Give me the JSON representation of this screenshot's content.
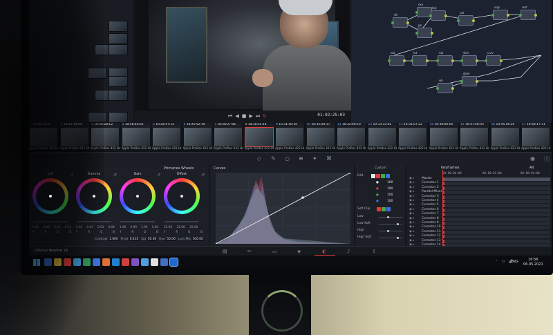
{
  "viewer": {
    "timecode": "01:02:25:03",
    "transport_icons": [
      "skip-back-icon",
      "play-reverse-icon",
      "stop-icon",
      "play-icon",
      "skip-forward-icon",
      "loop-icon"
    ]
  },
  "nodes": [
    {
      "label": "exp",
      "num": "01"
    },
    {
      "label": "dh",
      "num": "02"
    },
    {
      "label": "pp",
      "num": "03"
    },
    {
      "label": "sat",
      "num": "04"
    },
    {
      "label": "key",
      "num": "05"
    },
    {
      "label": "vign",
      "num": "06"
    },
    {
      "label": "rest",
      "num": "07"
    },
    {
      "label": "sat",
      "num": "08"
    },
    {
      "label": "lut",
      "num": "09"
    },
    {
      "label": "sat",
      "num": "10"
    },
    {
      "label": "skin",
      "num": "11"
    },
    {
      "label": "curv",
      "num": "12"
    },
    {
      "label": "glow",
      "num": "13"
    },
    {
      "label": "wb",
      "num": "14"
    }
  ],
  "clips": [
    {
      "num": "1",
      "tc": "10:26:13:21",
      "name": "Apple ProRes 422 HQ"
    },
    {
      "num": "2",
      "tc": "10:26:19:04",
      "name": "Apple ProRes 422 HQ"
    },
    {
      "num": "3",
      "tc": "10:26:28:12",
      "name": "Apple ProRes 422 HQ"
    },
    {
      "num": "4",
      "tc": "10:26:40:03",
      "name": "Apple ProRes 422 HQ"
    },
    {
      "num": "5",
      "tc": "10:26:47:12",
      "name": "Apple ProRes 422 HQ"
    },
    {
      "num": "6",
      "tc": "10:26:52:19",
      "name": "Apple ProRes 422 HQ"
    },
    {
      "num": "7",
      "tc": "10:28:27:06",
      "name": "Apple ProRes 422 HQ"
    },
    {
      "num": "8",
      "tc": "10:30:25:14",
      "name": "Apple ProRes 422 HQ",
      "selected": true
    },
    {
      "num": "9",
      "tc": "10:31:40:10",
      "name": "Apple ProRes 422 HQ"
    },
    {
      "num": "10",
      "tc": "10:32:20:17",
      "name": "Apple ProRes 422 HQ"
    },
    {
      "num": "11",
      "tc": "10:32:49:19",
      "name": "Apple ProRes 422 HQ"
    },
    {
      "num": "12",
      "tc": "10:33:32:02",
      "name": "Apple ProRes 422 HQ"
    },
    {
      "num": "13",
      "tc": "10:35:07:22",
      "name": "Apple ProRes 422 HQ"
    },
    {
      "num": "14",
      "tc": "10:39:06:05",
      "name": "Apple ProRes 422 HQ"
    },
    {
      "num": "15",
      "tc": "10:47:56:03",
      "name": "Apple ProRes 422 HQ"
    },
    {
      "num": "16",
      "tc": "10:55:56:20",
      "name": "Apple ProRes 422 HQ"
    },
    {
      "num": "17",
      "tc": "10:58:17:11",
      "name": "Apple ProRes 422 HQ"
    }
  ],
  "wheels": {
    "title": "Primaries Wheels",
    "items": [
      {
        "name": "Lift",
        "vals": [
          "0.01",
          "0.00",
          "0.01",
          "0.01"
        ]
      },
      {
        "name": "Gamma",
        "vals": [
          "0.02",
          "0.02",
          "0.01",
          "0.04"
        ]
      },
      {
        "name": "Gain",
        "vals": [
          "1.00",
          "0.99",
          "1.00",
          "1.00"
        ]
      },
      {
        "name": "Offset",
        "vals": [
          "25.00",
          "25.00",
          "25.00",
          ""
        ]
      }
    ],
    "channels": [
      "Y",
      "R",
      "G",
      "B"
    ],
    "params": {
      "contrast_label": "Contrast",
      "contrast": "1.000",
      "pivot_label": "Pivot",
      "pivot": "0.435",
      "sat_label": "Sat",
      "sat": "50.00",
      "hue_label": "Hue",
      "hue": "50.00",
      "lum_mix_label": "Lum Mix",
      "lum_mix": "100.00"
    }
  },
  "curves": {
    "title": "Curves"
  },
  "side": {
    "custom_label": "Custom",
    "edit_label": "Edit",
    "soft_clip_label": "Soft Clip",
    "values": [
      "100",
      "100",
      "100",
      "100"
    ],
    "rows": [
      "Low",
      "Low Soft",
      "High",
      "High Soft"
    ]
  },
  "keyframes": {
    "title": "Keyframes",
    "filter": "All",
    "times": [
      "00:00:00:00",
      "00:00:02:00",
      "00:00:04:00"
    ],
    "rows": [
      "Master",
      "Corrector 1",
      "Corrector 2",
      "Parallel Mixer",
      "Corrector 3",
      "Corrector 4",
      "Corrector 5",
      "Corrector 6",
      "Corrector 7",
      "Corrector 8",
      "Corrector 9",
      "Corrector 10",
      "Corrector 11",
      "Corrector 12",
      "Corrector 13",
      "Corrector 14"
    ]
  },
  "page_bar": {
    "app_name": "DaVinci Resolve 16",
    "pages": [
      "media-icon",
      "cut-icon",
      "edit-icon",
      "fusion-icon",
      "color-icon",
      "fairlight-icon",
      "deliver-icon"
    ]
  },
  "taskbar": {
    "lang": "ENG",
    "time": "16:56",
    "date": "06.05.2021"
  },
  "colors": {
    "accent": "#e03a3a",
    "selection": "#ffb33a",
    "clip_number": "#6aa1ff"
  }
}
